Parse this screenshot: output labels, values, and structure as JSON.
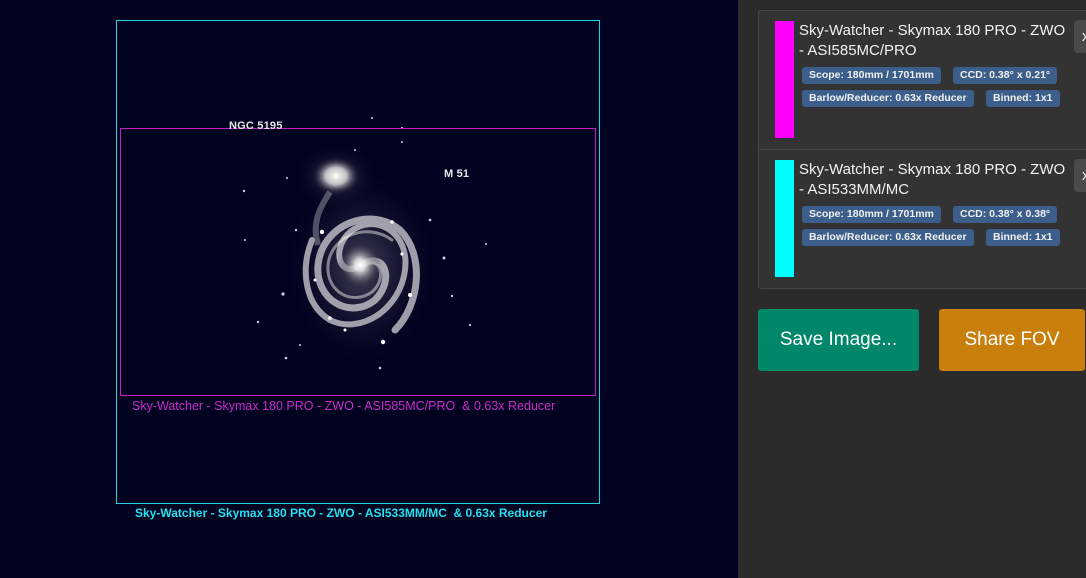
{
  "preview": {
    "objects": {
      "ngc": "NGC 5195",
      "m51": "M 51"
    },
    "fovs": [
      {
        "caption": "Sky-Watcher - Skymax 180 PRO - ZWO - ASI585MC/PRO  & 0.63x Reducer",
        "color": "#c21ec2"
      },
      {
        "caption": "Sky-Watcher - Skymax 180 PRO - ZWO - ASI533MM/MC  & 0.63x Reducer",
        "color": "#1fd3e0"
      }
    ]
  },
  "equipment": [
    {
      "title": "Sky-Watcher - Skymax 180 PRO - ZWO - ASI585MC/PRO",
      "color": "#ff00ff",
      "scope": "Scope: 180mm / 1701mm",
      "ccd": "CCD: 0.38° x 0.21°",
      "barlow": "Barlow/Reducer: 0.63x Reducer",
      "binned": "Binned: 1x1",
      "remove_label": "x"
    },
    {
      "title": "Sky-Watcher - Skymax 180 PRO - ZWO - ASI533MM/MC",
      "color": "#00ffff",
      "scope": "Scope: 180mm / 1701mm",
      "ccd": "CCD: 0.38° x 0.38°",
      "barlow": "Barlow/Reducer: 0.63x Reducer",
      "binned": "Binned: 1x1",
      "remove_label": "x"
    }
  ],
  "actions": {
    "save_label": "Save Image...",
    "share_label": "Share FOV"
  },
  "colors": {
    "save": "#00876a",
    "share": "#c97f0b",
    "badge": "#3b5f8a",
    "sky": "#010220"
  },
  "icons": {
    "remove": "close-icon"
  }
}
